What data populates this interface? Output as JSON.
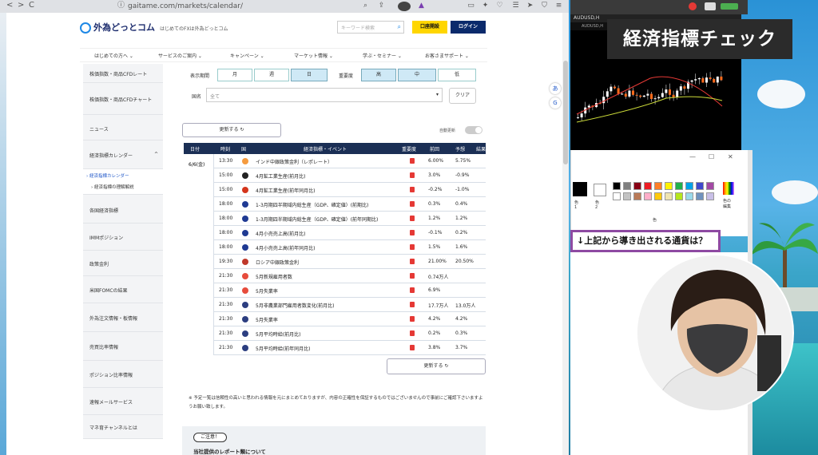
{
  "browser": {
    "url": "gaitame.com/markets/calendar/",
    "nav_back": "<",
    "nav_fwd": ">",
    "reload": "C"
  },
  "site": {
    "logo": "外為どっとコム",
    "tagline": "はじめてのFXは外為どっとコム",
    "search_placeholder": "キーワード検索",
    "open_account": "口座開設",
    "login": "ログイン",
    "global_nav": [
      "はじめての方へ ⌄",
      "サービスのご案内 ⌄",
      "キャンペーン ⌄",
      "マーケット情報 ⌄",
      "学ぶ・セミナー ⌄",
      "お客さまサポート ⌄"
    ]
  },
  "sidebar": {
    "items": [
      "株価指数・商品CFDレート",
      "株価指数・商品CFDチャート",
      "ニュース",
      "経済指標カレンダー",
      "各国経済指標",
      "IMMポジション",
      "政策金利",
      "米国FOMCの結果",
      "外為注文情報・板情報",
      "売買比率情報",
      "ポジション比率情報",
      "速報メールサービス",
      "マネ育チャンネルとは"
    ],
    "expand_mark": "^",
    "sub_items": [
      "› 経済指標カレンダー",
      "› 経済指標の理解解説"
    ]
  },
  "filters": {
    "display_period_label": "表示期間",
    "periods": [
      "月",
      "週",
      "日"
    ],
    "importance_label": "重要度",
    "importance": [
      "高",
      "中",
      "低"
    ],
    "country_label": "国名",
    "country_value": "全て",
    "clear": "クリア"
  },
  "refresh_label": "更新する ↻",
  "auto_update_label": "自動更新",
  "table": {
    "headers": [
      "日付",
      "時刻",
      "国",
      "経済指標・イベント",
      "重要度",
      "前回",
      "予想",
      "結果"
    ],
    "date": "6/6(金)",
    "rows": [
      {
        "time": "13:30",
        "flag": "#f59b3f",
        "event": "インド中銀政策金利（レポレート）",
        "prev": "6.00%",
        "fcst": "5.75%"
      },
      {
        "time": "15:00",
        "flag": "#222222",
        "event": "4月鉱工業生産(前月比)",
        "prev": "3.0%",
        "fcst": "-0.9%"
      },
      {
        "time": "15:00",
        "flag": "#d4351c",
        "event": "4月鉱工業生産(前年同月比)",
        "prev": "-0.2%",
        "fcst": "-1.0%"
      },
      {
        "time": "18:00",
        "flag": "#1f3a93",
        "event": "1-3月期四半期域内総生産（GDP、確定値）(前期比)",
        "prev": "0.3%",
        "fcst": "0.4%"
      },
      {
        "time": "18:00",
        "flag": "#1f3a93",
        "event": "1-3月期四半期域内総生産（GDP、確定値）(前年同期比)",
        "prev": "1.2%",
        "fcst": "1.2%"
      },
      {
        "time": "18:00",
        "flag": "#1f3a93",
        "event": "4月小売売上高(前月比)",
        "prev": "-0.1%",
        "fcst": "0.2%"
      },
      {
        "time": "18:00",
        "flag": "#1f3a93",
        "event": "4月小売売上高(前年同月比)",
        "prev": "1.5%",
        "fcst": "1.6%"
      },
      {
        "time": "19:30",
        "flag": "#c0392b",
        "event": "ロシア中銀政策金利",
        "prev": "21.00%",
        "fcst": "20.50%"
      },
      {
        "time": "21:30",
        "flag": "#e74c3c",
        "event": "5月新規雇用者数",
        "prev": "0.74万人",
        "fcst": ""
      },
      {
        "time": "21:30",
        "flag": "#e74c3c",
        "event": "5月失業率",
        "prev": "6.9%",
        "fcst": ""
      },
      {
        "time": "21:30",
        "flag": "#2c3e80",
        "event": "5月非農業部門雇用者数変化(前月比)",
        "prev": "17.7万人",
        "fcst": "13.0万人"
      },
      {
        "time": "21:30",
        "flag": "#2c3e80",
        "event": "5月失業率",
        "prev": "4.2%",
        "fcst": "4.2%"
      },
      {
        "time": "21:30",
        "flag": "#2c3e80",
        "event": "5月平均時給(前月比)",
        "prev": "0.2%",
        "fcst": "0.3%"
      },
      {
        "time": "21:30",
        "flag": "#2c3e80",
        "event": "5月平均時給(前年同月比)",
        "prev": "3.8%",
        "fcst": "3.7%"
      }
    ]
  },
  "notice": "※ 予定一覧は信頼性の高いと思われる情報を元にまとめておりますが、内容の正確性を保証するものではございませんので事前にご確認下さいますようお願い致します。",
  "notebox": {
    "tag": "ご注意！",
    "title": "当社提供のレポート類について"
  },
  "overlay_title": "経済指標チェック",
  "side_note": "↓上記から導き出される通貨は？",
  "mt4": {
    "title": "AUDUSD,H",
    "tab": "AUDUSD,H"
  },
  "paint": {
    "label1": "色\n1",
    "label2": "色\n2",
    "label3": "色の\n編集",
    "label_center": "色"
  }
}
